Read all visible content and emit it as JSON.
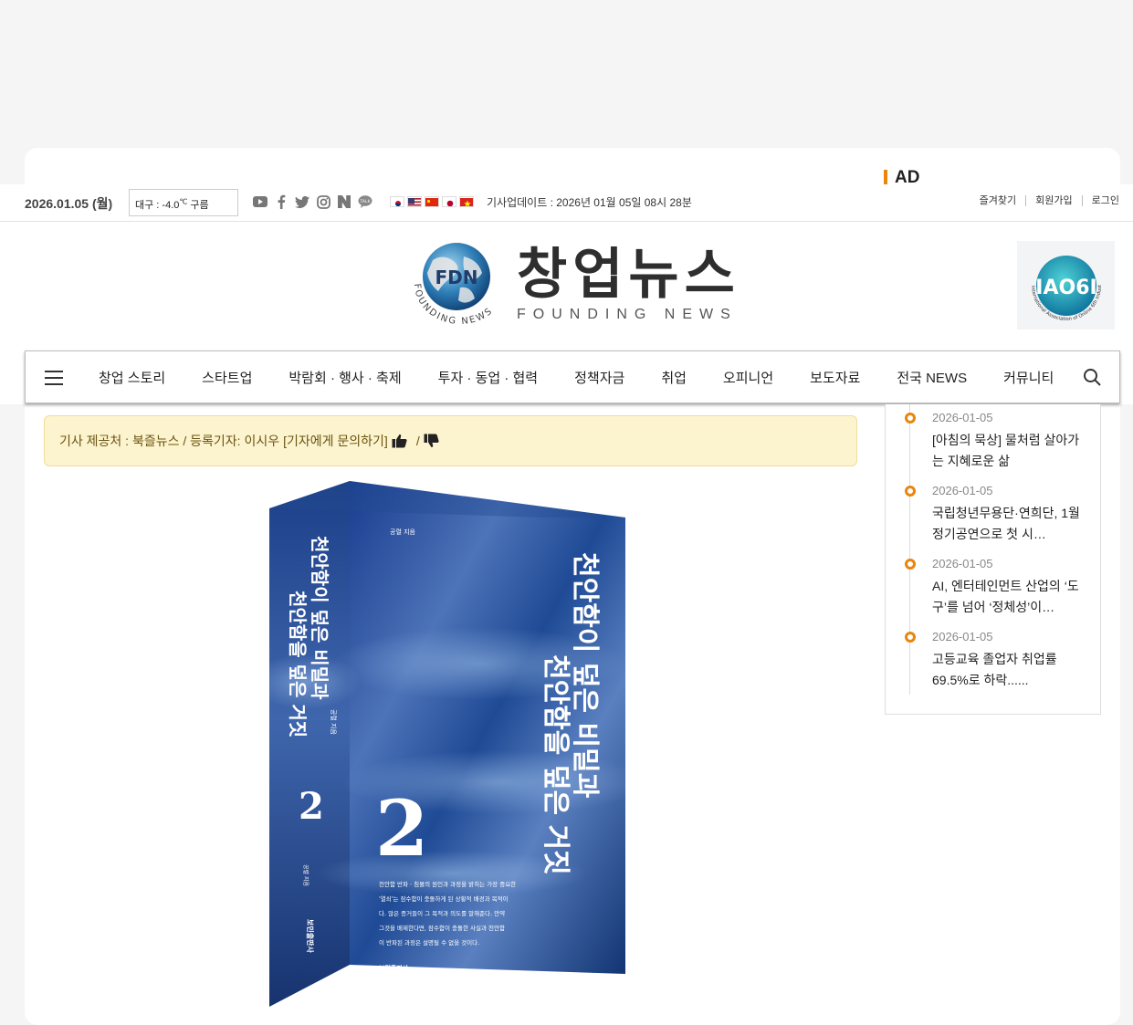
{
  "ad": {
    "label": "AD"
  },
  "topbar": {
    "date": "2026.01.05 (월)",
    "weather": {
      "city": "대구 : -4.0",
      "unit": "℃",
      "cond": "구름"
    },
    "socials": [
      "youtube-icon",
      "facebook-icon",
      "twitter-icon",
      "instagram-icon",
      "naver-icon",
      "talk-icon"
    ],
    "flags": [
      "korea",
      "usa",
      "china",
      "japan",
      "vietnam"
    ],
    "updated": "기사업데이트 : 2026년 01월 05일 08시 28분",
    "links": [
      "즐겨찾기",
      "회원가입",
      "로그인"
    ]
  },
  "header": {
    "logo_kr": "창업뉴스",
    "logo_en": "FOUNDING NEWS",
    "globe_text": "FDN",
    "globe_ring": "FOUNDING NEWS",
    "badge_text": "IAO6I",
    "badge_ring": "International Association of Online 6th Industries"
  },
  "nav": {
    "items": [
      "창업 스토리",
      "스타트업",
      "박람회 · 행사 · 축제",
      "투자 · 동업 · 협력",
      "정책자금",
      "취업",
      "오피니언",
      "보도자료",
      "전국 NEWS",
      "커뮤니티"
    ]
  },
  "article": {
    "credit_source": "기사 제공처 : 북즐뉴스 / 등록기자: 이시우",
    "credit_link": "[기자에게 문의하기]",
    "credit_sep": "/"
  },
  "book": {
    "spine_title_1": "천안함이 덮은 비밀과",
    "spine_title_2": "천안함을 덮은 거짓",
    "spine_author": "공렬 지음",
    "spine_number": "2",
    "spine_bottom_author": "공렬 지음",
    "spine_publisher": "보민출판사",
    "cover_author": "공렬 지음",
    "cover_title_1": "천안함이 덮은 비밀과",
    "cover_title_2": "천안함을 덮은 거짓",
    "cover_number": "2",
    "cover_blurb": [
      "천안함 반파 · 침몰의 원인과 과정을 밝히는 가장 중요한",
      "'열쇠'는 잠수함이 충돌하게 된 상황적 배경과 목적이",
      "다. 많은 증거들이 그 목적과 의도를 말해준다. 만약",
      "그것을 배제한다면, 잠수함이 충돌한 사실과 천안함",
      "이 반파된 과정은 설명될 수 없을 것이다."
    ],
    "cover_publisher": "보민출판사"
  },
  "sidebar": {
    "news": [
      {
        "date": "2026-01-05",
        "title": "[아침의 묵상] 물처럼 살아가는 지혜로운 삶"
      },
      {
        "date": "2026-01-05",
        "title": "국립청년무용단·연희단, 1월 정기공연으로 첫 시…"
      },
      {
        "date": "2026-01-05",
        "title": "AI, 엔터테인먼트 산업의 ‘도구’를 넘어 ‘정체성’이…"
      },
      {
        "date": "2026-01-05",
        "title": "고등교육 졸업자 취업률 69.5%로 하락......"
      }
    ]
  },
  "colors": {
    "accent": "#e8860e",
    "credit_bg": "#fcf3cf",
    "book_blue": "#1c3f86"
  }
}
